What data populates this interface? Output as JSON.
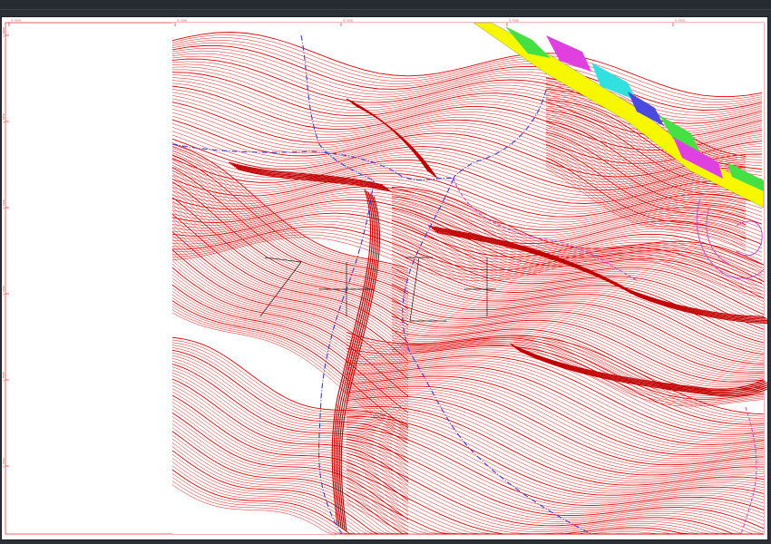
{
  "viewer": {
    "background": "#2b2f36",
    "sheet_background": "#ffffff"
  },
  "map": {
    "contour_color": "#e00000",
    "stream_color": "#3b3bd6",
    "stream_secondary_color": "#c04cd0",
    "section_line_color": "#1a1a1a",
    "road_colors": [
      "#f7f700",
      "#44e044",
      "#e040e0",
      "#33e0e0",
      "#4a4adf"
    ],
    "frame_color": "#e00000"
  },
  "frame": {
    "top_ticks": [
      "4.7050",
      "4.7200",
      "4.7350",
      "4.7500",
      "4.7650",
      "4.7800"
    ],
    "left_ticks": [
      "4.6900",
      "4.7050",
      "4.7200",
      "4.7350",
      "4.7500",
      "4.7650"
    ]
  }
}
